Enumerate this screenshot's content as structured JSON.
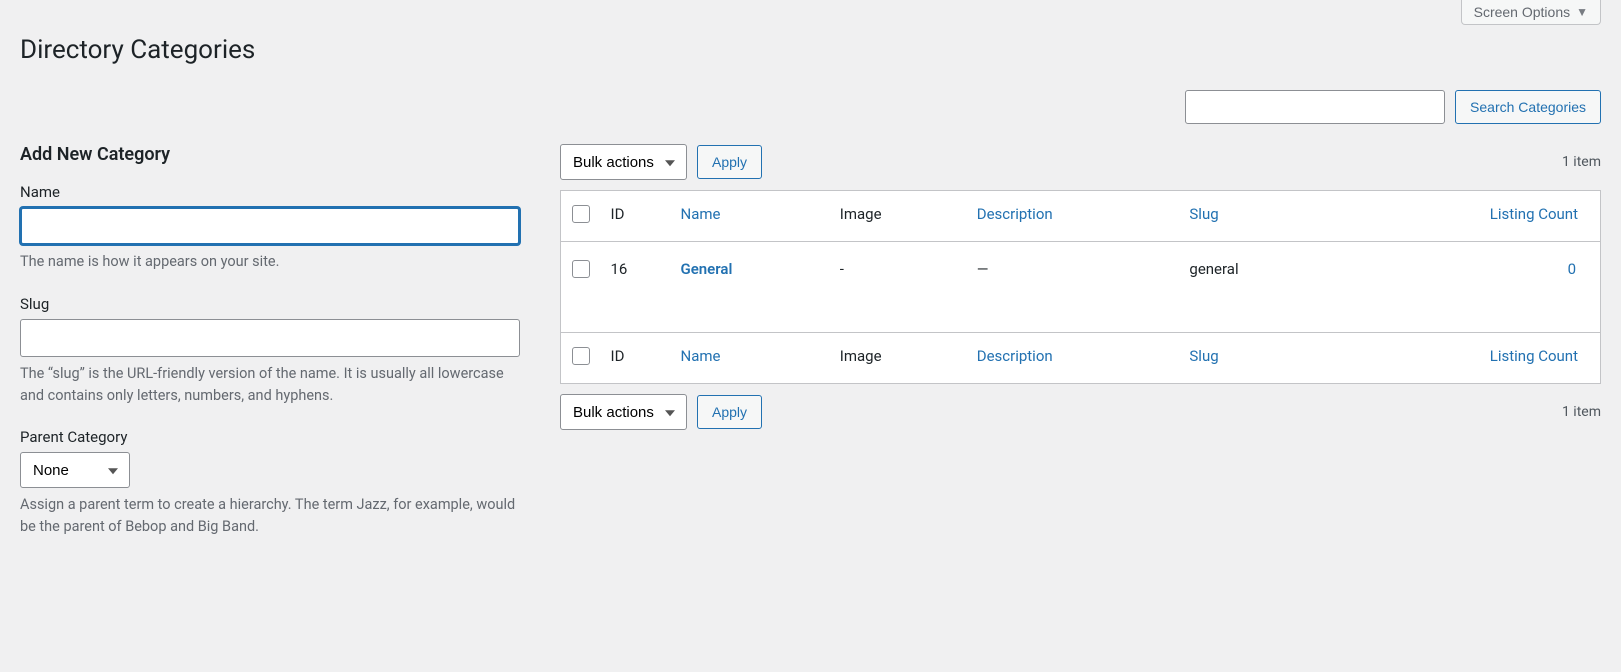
{
  "screen_options_label": "Screen Options",
  "page_title": "Directory Categories",
  "search": {
    "value": "",
    "button": "Search Categories"
  },
  "form": {
    "heading": "Add New Category",
    "name": {
      "label": "Name",
      "value": "",
      "desc": "The name is how it appears on your site."
    },
    "slug": {
      "label": "Slug",
      "value": "",
      "desc": "The “slug” is the URL-friendly version of the name. It is usually all lowercase and contains only letters, numbers, and hyphens."
    },
    "parent": {
      "label": "Parent Category",
      "selected": "None",
      "desc": "Assign a parent term to create a hierarchy. The term Jazz, for example, would be the parent of Bebop and Big Band."
    }
  },
  "bulk": {
    "label": "Bulk actions",
    "apply": "Apply"
  },
  "item_count_text": "1 item",
  "columns": {
    "id": "ID",
    "name": "Name",
    "image": "Image",
    "description": "Description",
    "slug": "Slug",
    "listing_count": "Listing Count"
  },
  "rows": [
    {
      "id": "16",
      "name": "General",
      "image": "-",
      "description": "—",
      "slug": "general",
      "listing_count": "0"
    }
  ]
}
